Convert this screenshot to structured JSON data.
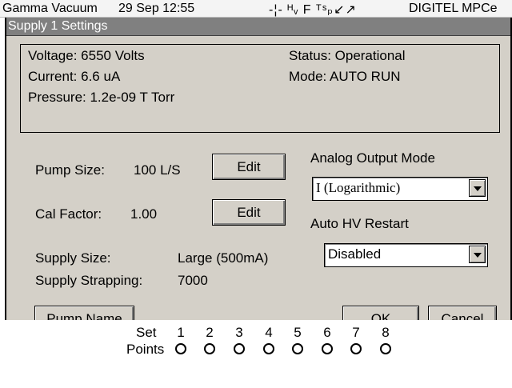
{
  "topbar": {
    "device": "Gamma Vacuum",
    "datetime": "29 Sep 12:55",
    "indicators": "-¦- ᴴᵥ F ᵀˢₚ↙↗",
    "product": "DIGITEL MPCe"
  },
  "window": {
    "title": "Supply 1 Settings"
  },
  "status": {
    "voltage": "Voltage: 6550 Volts",
    "current": "Current: 6.6 uA",
    "pressure": "Pressure: 1.2e-09 T Torr",
    "state": "Status: Operational",
    "mode": "Mode: AUTO RUN"
  },
  "settings": {
    "pump_size_label": "Pump Size:",
    "pump_size_value": "100 L/S",
    "cal_factor_label": "Cal Factor:",
    "cal_factor_value": "1.00",
    "edit_label": "Edit",
    "supply_size_label": "Supply Size:",
    "supply_size_value": "Large (500mA)",
    "supply_strapping_label": "Supply Strapping:",
    "supply_strapping_value": "7000"
  },
  "analog_output": {
    "label": "Analog Output Mode",
    "selected": "I (Logarithmic)"
  },
  "auto_hv": {
    "label": "Auto HV Restart",
    "selected": "Disabled"
  },
  "buttons": {
    "pump_name": "Pump Name",
    "ok": "OK",
    "cancel": "Cancel"
  },
  "setpoints": {
    "label_line1": "Set",
    "label_line2": "Points",
    "numbers": [
      "1",
      "2",
      "3",
      "4",
      "5",
      "6",
      "7",
      "8"
    ]
  }
}
